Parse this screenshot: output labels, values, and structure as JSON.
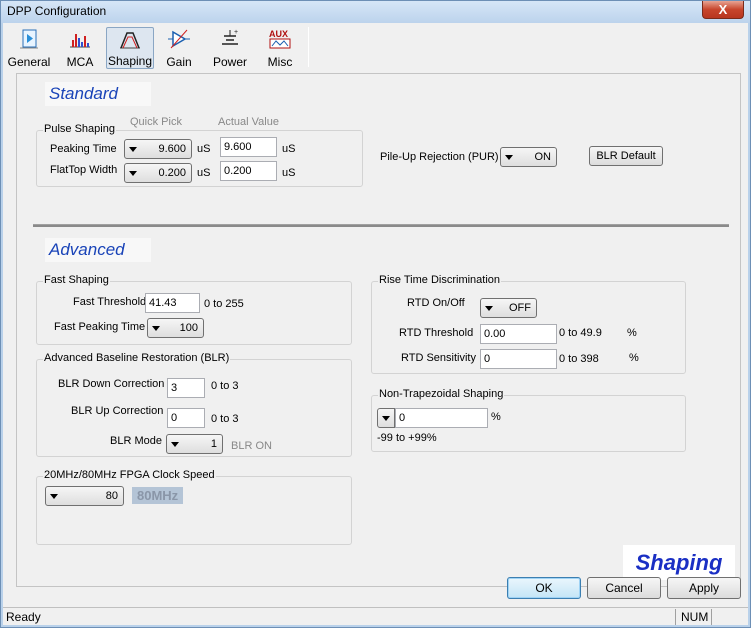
{
  "window": {
    "title": "DPP Configuration",
    "close": "X"
  },
  "toolbar": {
    "items": [
      {
        "label": "General",
        "icon": "general-icon"
      },
      {
        "label": "MCA",
        "icon": "mca-icon"
      },
      {
        "label": "Shaping",
        "icon": "shaping-icon",
        "active": true
      },
      {
        "label": "Gain",
        "icon": "gain-icon"
      },
      {
        "label": "Power",
        "icon": "power-icon"
      },
      {
        "label": "Misc",
        "icon": "misc-icon",
        "icon_text": "AUX"
      }
    ]
  },
  "standard": {
    "title": "Standard",
    "quick_pick_header": "Quick Pick",
    "actual_value_header": "Actual Value",
    "pulse_shaping": {
      "title": "Pulse Shaping",
      "peaking_time": {
        "label": "Peaking Time",
        "quick": "9.600",
        "actual": "9.600",
        "unit": "uS"
      },
      "flattop_width": {
        "label": "FlatTop Width",
        "quick": "0.200",
        "actual": "0.200",
        "unit": "uS"
      }
    },
    "pur": {
      "label": "Pile-Up Rejection (PUR)",
      "value": "ON"
    },
    "blr_default": "BLR Default"
  },
  "advanced": {
    "title": "Advanced",
    "fast_shaping": {
      "title": "Fast Shaping",
      "threshold": {
        "label": "Fast Threshold",
        "value": "41.43",
        "range": "0 to 255"
      },
      "peaking_time": {
        "label": "Fast Peaking Time",
        "value": "100"
      }
    },
    "blr": {
      "title": "Advanced Baseline Restoration (BLR)",
      "down": {
        "label": "BLR Down Correction",
        "value": "3",
        "range": "0 to 3"
      },
      "up": {
        "label": "BLR Up Correction",
        "value": "0",
        "range": "0 to 3"
      },
      "mode": {
        "label": "BLR Mode",
        "value": "1",
        "status": "BLR ON"
      }
    },
    "clock": {
      "title": "20MHz/80MHz FPGA Clock Speed",
      "value": "80",
      "display": "80MHz"
    },
    "rtd": {
      "title": "Rise Time Discrimination",
      "onoff": {
        "label": "RTD On/Off",
        "value": "OFF"
      },
      "threshold": {
        "label": "RTD Threshold",
        "value": "0.00",
        "range": "0 to 49.9",
        "unit": "%"
      },
      "sensitivity": {
        "label": "RTD Sensitivity",
        "value": "0",
        "range": "0 to 398",
        "unit": "%"
      }
    },
    "nontrap": {
      "title": "Non-Trapezoidal Shaping",
      "value": "0",
      "unit": "%",
      "range": "-99 to +99%"
    }
  },
  "banner": "Shaping",
  "buttons": {
    "ok": "OK",
    "cancel": "Cancel",
    "apply": "Apply"
  },
  "status": {
    "text": "Ready",
    "num": "NUM"
  }
}
